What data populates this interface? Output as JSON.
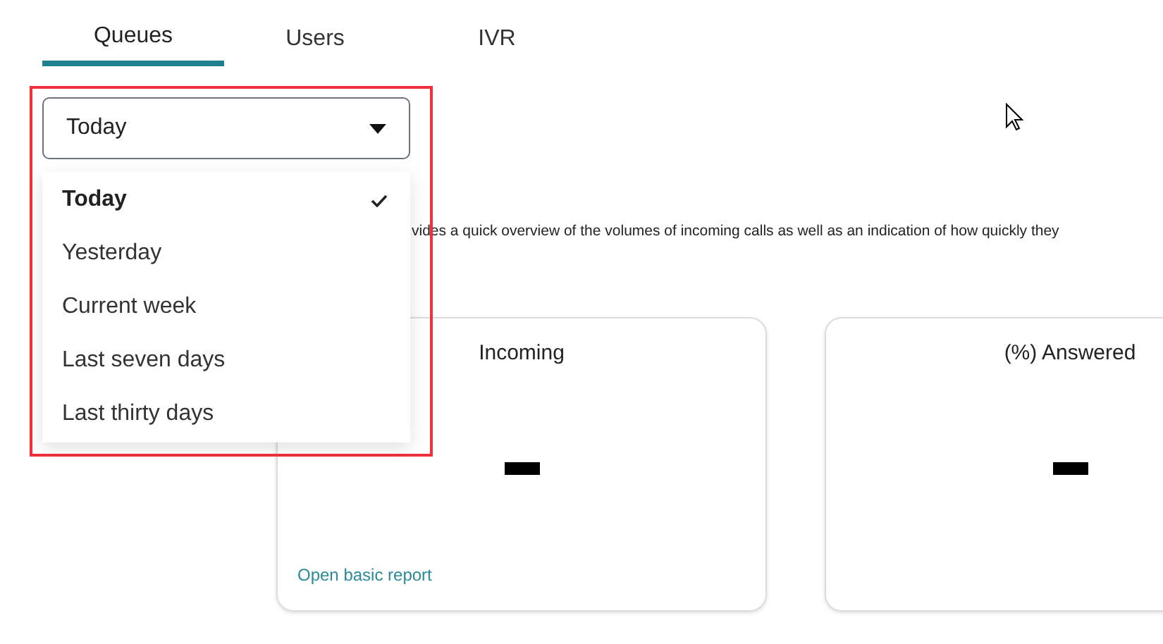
{
  "tabs": [
    {
      "label": "Queues",
      "selected": true
    },
    {
      "label": "Users",
      "selected": false
    },
    {
      "label": "IVR",
      "selected": false
    }
  ],
  "period_select": {
    "value": "Today",
    "options": [
      {
        "label": "Today",
        "selected": true
      },
      {
        "label": "Yesterday",
        "selected": false
      },
      {
        "label": "Current week",
        "selected": false
      },
      {
        "label": "Last seven days",
        "selected": false
      },
      {
        "label": "Last thirty days",
        "selected": false
      }
    ]
  },
  "description": "vides a quick overview of the volumes of incoming calls as well as an indication of how quickly they",
  "cards": [
    {
      "title": "Incoming",
      "link": "Open basic report"
    },
    {
      "title": "(%) Answered"
    }
  ]
}
